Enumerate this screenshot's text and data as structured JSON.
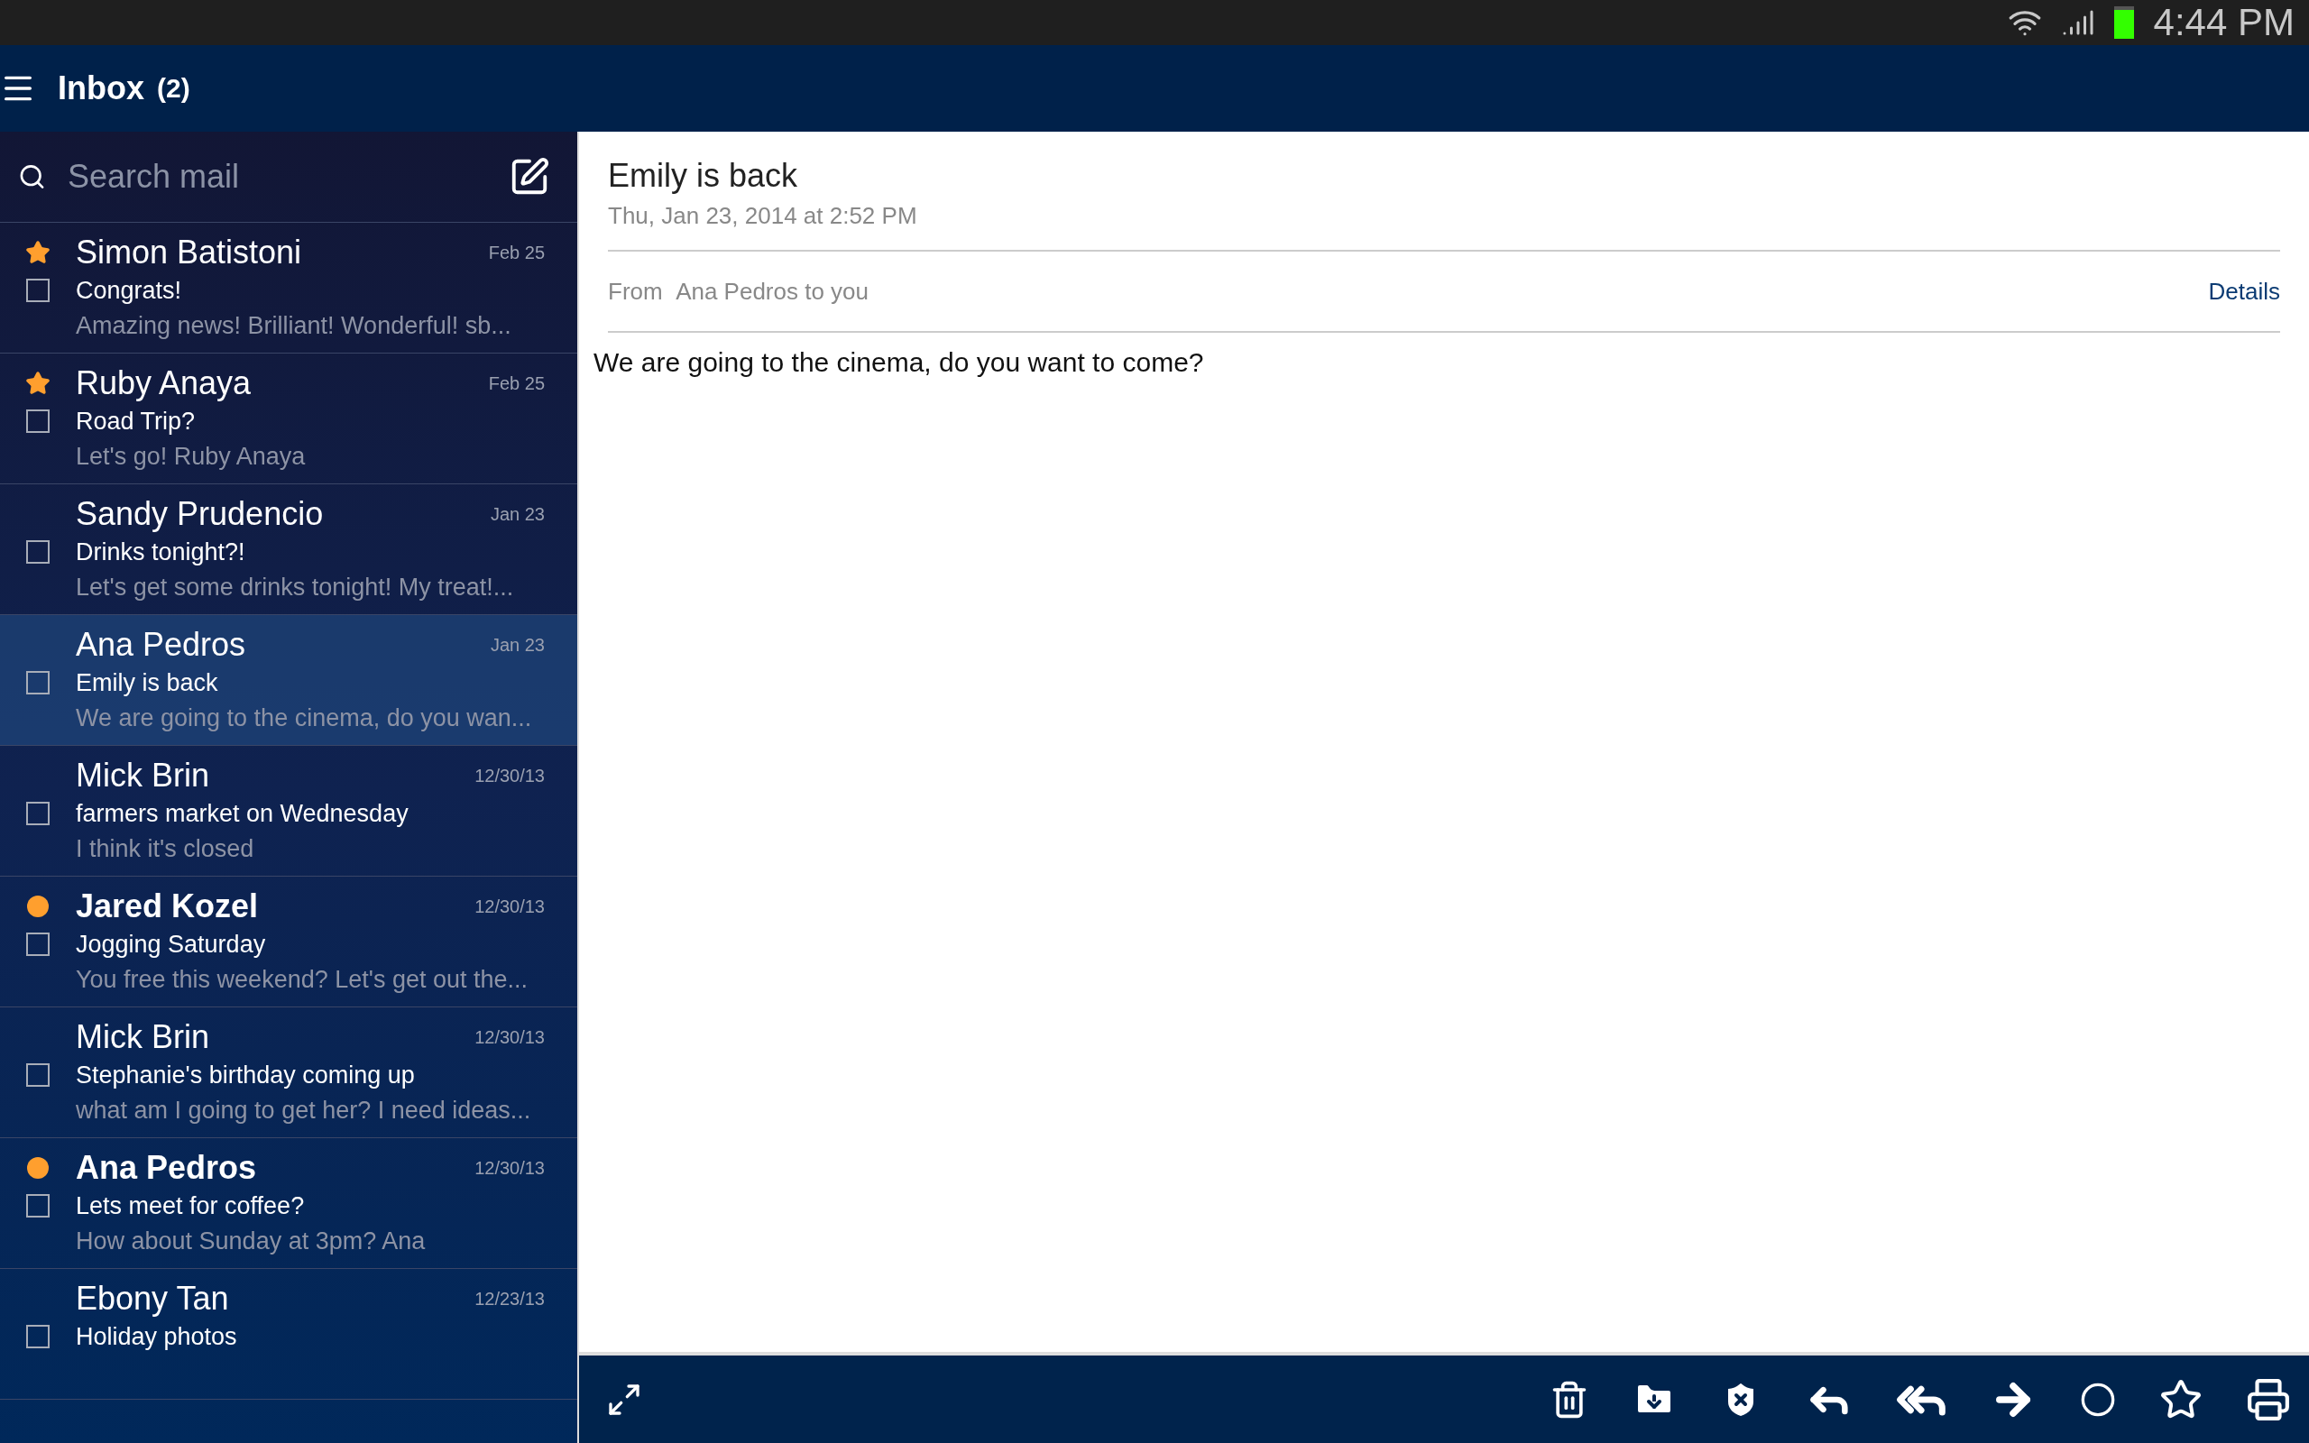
{
  "status_bar": {
    "time": "4:44 PM"
  },
  "header": {
    "title": "Inbox",
    "count": "(2)"
  },
  "search": {
    "placeholder": "Search mail"
  },
  "messages": [
    {
      "sender": "Simon Batistoni",
      "date": "Feb 25",
      "subject": "Congrats!",
      "preview": "Amazing news! Brilliant!  Wonderful!  sb...",
      "starred": true,
      "unread": false,
      "checked": false,
      "selected": false
    },
    {
      "sender": "Ruby Anaya",
      "date": "Feb 25",
      "subject": "Road Trip?",
      "preview": "Let's go! Ruby Anaya",
      "starred": true,
      "unread": false,
      "checked": false,
      "selected": false
    },
    {
      "sender": "Sandy Prudencio",
      "date": "Jan 23",
      "subject": "Drinks tonight?!",
      "preview": "Let's get some drinks tonight! My treat!...",
      "starred": false,
      "unread": false,
      "checked": false,
      "selected": false
    },
    {
      "sender": "Ana Pedros",
      "date": "Jan 23",
      "subject": "Emily is back",
      "preview": "We are going to the cinema, do you wan...",
      "starred": false,
      "unread": false,
      "checked": false,
      "selected": true
    },
    {
      "sender": "Mick Brin",
      "date": "12/30/13",
      "subject": "farmers market on Wednesday",
      "preview": "I think it's closed",
      "starred": false,
      "unread": false,
      "checked": false,
      "selected": false
    },
    {
      "sender": "Jared Kozel",
      "date": "12/30/13",
      "subject": "Jogging Saturday",
      "preview": "You free this weekend? Let's get out the...",
      "starred": false,
      "unread": true,
      "checked": false,
      "selected": false
    },
    {
      "sender": "Mick Brin",
      "date": "12/30/13",
      "subject": "Stephanie's birthday coming up",
      "preview": "what am I going to get her? I need ideas...",
      "starred": false,
      "unread": false,
      "checked": false,
      "selected": false
    },
    {
      "sender": "Ana Pedros",
      "date": "12/30/13",
      "subject": "Lets meet for coffee?",
      "preview": "How about Sunday at 3pm? Ana",
      "starred": false,
      "unread": true,
      "checked": false,
      "selected": false
    },
    {
      "sender": "Ebony Tan",
      "date": "12/23/13",
      "subject": "Holiday photos",
      "starred": false,
      "unread": false,
      "checked": false,
      "selected": false
    }
  ],
  "message_view": {
    "subject": "Emily is back",
    "date": "Thu, Jan 23, 2014 at 2:52 PM",
    "from_label": "From",
    "from": "Ana Pedros to you",
    "details": "Details",
    "body": "We are going to the cinema, do you want to come?"
  }
}
